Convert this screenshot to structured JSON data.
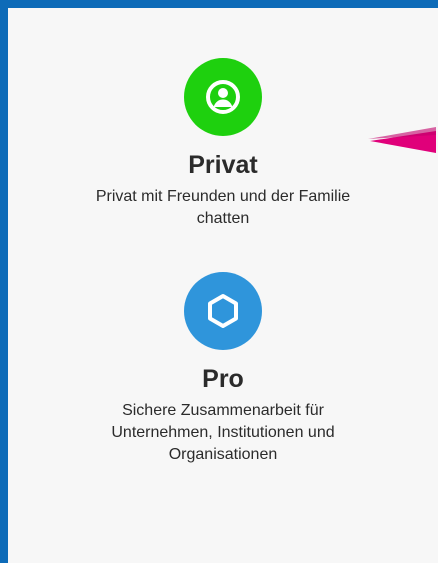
{
  "options": [
    {
      "id": "private",
      "icon": "user-circle-icon",
      "color": "#1ed00e",
      "title": "Privat",
      "description": "Privat mit Freunden und der Familie chatten"
    },
    {
      "id": "pro",
      "icon": "hexagon-icon",
      "color": "#2f95db",
      "title": "Pro",
      "description": "Sichere Zusammenarbeit für Unternehmen, Institutionen und Organisationen"
    }
  ],
  "colors": {
    "frame_border": "#0d6bb8",
    "background": "#f7f7f7",
    "annotation_arrow": "#e0007a"
  }
}
